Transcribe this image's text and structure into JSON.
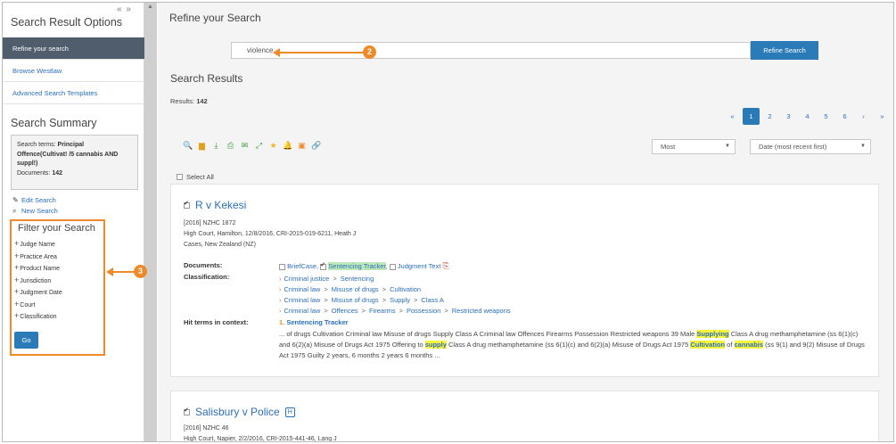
{
  "sidebar": {
    "title": "Search Result Options",
    "collapse_glyph": "« »",
    "nav": [
      {
        "label": "Refine your search",
        "active": true
      },
      {
        "label": "Browse Westlaw",
        "active": false
      },
      {
        "label": "Advanced Search Templates",
        "active": false
      }
    ],
    "summary_title": "Search Summary",
    "summary": {
      "terms_label": "Search terms:",
      "terms_value": "Principal Offence(Cultivat! /5 cannabis AND suppl!)",
      "documents_label": "Documents:",
      "documents_value": "142"
    },
    "edit_search": "Edit Search",
    "new_search": "New Search",
    "filter": {
      "title": "Filter your Search",
      "items": [
        "Judge Name",
        "Practice Area",
        "Product Name",
        "Jurisdiction",
        "Judgment Date",
        "Court",
        "Classification"
      ],
      "go_label": "Go"
    }
  },
  "main": {
    "title": "Refine your Search",
    "search_value": "violence",
    "refine_button": "Refine Search",
    "results_title": "Search Results",
    "results_label": "Results:",
    "results_count": "142",
    "pages": [
      "«",
      "1",
      "2",
      "3",
      "4",
      "5",
      "6",
      "›",
      "»"
    ],
    "active_page": "1",
    "sort_select": "Most",
    "date_select": "Date (most recent first)",
    "select_all": "Select All"
  },
  "results": [
    {
      "title": "R v Kekesi",
      "citation": "[2016] NZHC 1872",
      "court_line": "High Court, Hamilton, 12/8/2016, CRI-2015-019-6211, Heath J",
      "report": "Cases, New Zealand (NZ)",
      "documents_label": "Documents:",
      "doc_briefcase": "BriefCase,",
      "doc_tracker": "Sentencing Tracker",
      "doc_judgment": "Judgment Text",
      "classification_label": "Classification:",
      "classifications": [
        [
          "Criminal justice",
          "Sentencing"
        ],
        [
          "Criminal law",
          "Misuse of drugs",
          "Cultivation"
        ],
        [
          "Criminal law",
          "Misuse of drugs",
          "Supply",
          "Class A"
        ],
        [
          "Criminal law",
          "Offences",
          "Firearms",
          "Possession",
          "Restricted weapons"
        ]
      ],
      "hits_label": "Hit terms in context:",
      "hit_number": "1.",
      "hit_title": "Sentencing Tracker",
      "hit_text_1": "... of drugs Cultivation Criminal law Misuse of drugs Supply Class A Criminal law Offences Firearms Possession Restricted weapons 39 Male ",
      "hit_mark_1": "Supplying",
      "hit_text_2": " Class A drug methamphetamine (ss 6(1)(c) and 6(2)(a) Misuse of Drugs Act 1975 Offering to ",
      "hit_mark_2": "supply",
      "hit_text_3": " Class A drug methamphetamine (ss 6(1)(c) and 6(2)(a) Misuse of Drugs Act 1975 ",
      "hit_mark_3": "Cultivation",
      "hit_text_4": " of ",
      "hit_mark_4": "cannabis",
      "hit_text_5": " (ss 9(1) and 9(2) Misuse of Drugs Act 1975 Guilty 2 years, 6 months 2 years 6 months ..."
    },
    {
      "title": "Salisbury v Police",
      "badge": "H",
      "citation": "[2016] NZHC 46",
      "court_line": "High Court, Napier, 2/2/2016, CRI-2015-441-46, Lang J"
    }
  ],
  "annotations": {
    "callout_2": "2",
    "callout_3": "3"
  },
  "colors": {
    "accent": "#2b7bb9",
    "highlight": "#ef8a2b",
    "nav_active": "#4f5d6d"
  }
}
